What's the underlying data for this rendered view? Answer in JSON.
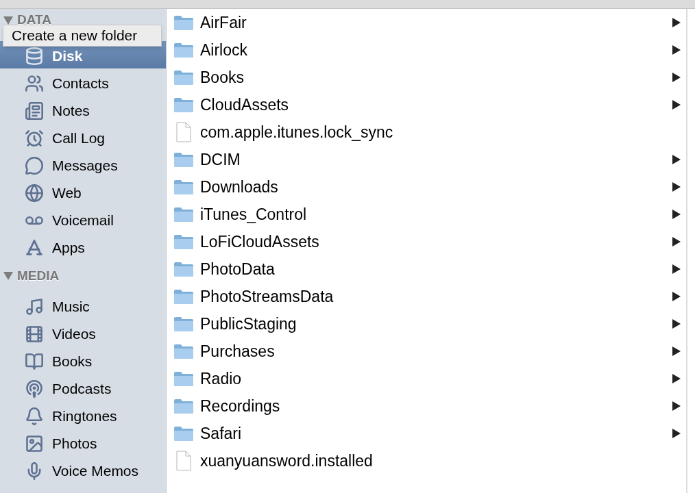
{
  "tooltip": {
    "text": "Create a new folder"
  },
  "sidebar": {
    "sections": [
      {
        "title": "DATA",
        "expanded": true,
        "items": [
          {
            "label": "Disk",
            "selected": true
          },
          {
            "label": "Contacts",
            "selected": false
          },
          {
            "label": "Notes",
            "selected": false
          },
          {
            "label": "Call Log",
            "selected": false
          },
          {
            "label": "Messages",
            "selected": false
          },
          {
            "label": "Web",
            "selected": false
          },
          {
            "label": "Voicemail",
            "selected": false
          },
          {
            "label": "Apps",
            "selected": false
          }
        ]
      },
      {
        "title": "MEDIA",
        "expanded": true,
        "items": [
          {
            "label": "Music",
            "selected": false
          },
          {
            "label": "Videos",
            "selected": false
          },
          {
            "label": "Books",
            "selected": false
          },
          {
            "label": "Podcasts",
            "selected": false
          },
          {
            "label": "Ringtones",
            "selected": false
          },
          {
            "label": "Photos",
            "selected": false
          },
          {
            "label": "Voice Memos",
            "selected": false
          }
        ]
      }
    ]
  },
  "files": [
    {
      "name": "AirFair",
      "kind": "folder"
    },
    {
      "name": "Airlock",
      "kind": "folder"
    },
    {
      "name": "Books",
      "kind": "folder"
    },
    {
      "name": "CloudAssets",
      "kind": "folder"
    },
    {
      "name": "com.apple.itunes.lock_sync",
      "kind": "file"
    },
    {
      "name": "DCIM",
      "kind": "folder"
    },
    {
      "name": "Downloads",
      "kind": "folder"
    },
    {
      "name": "iTunes_Control",
      "kind": "folder"
    },
    {
      "name": "LoFiCloudAssets",
      "kind": "folder"
    },
    {
      "name": "PhotoData",
      "kind": "folder"
    },
    {
      "name": "PhotoStreamsData",
      "kind": "folder"
    },
    {
      "name": "PublicStaging",
      "kind": "folder"
    },
    {
      "name": "Purchases",
      "kind": "folder"
    },
    {
      "name": "Radio",
      "kind": "folder"
    },
    {
      "name": "Recordings",
      "kind": "folder"
    },
    {
      "name": "Safari",
      "kind": "folder"
    },
    {
      "name": "xuanyuansword.installed",
      "kind": "file"
    }
  ]
}
